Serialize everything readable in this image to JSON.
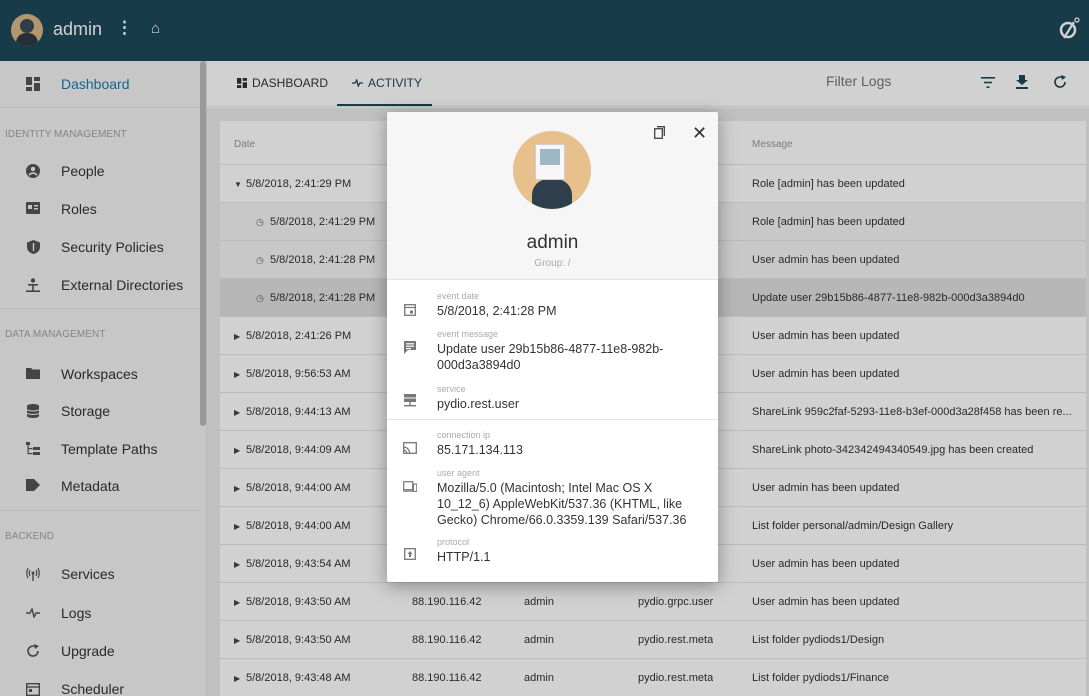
{
  "appbar": {
    "username": "admin",
    "kebab": "⋮",
    "home_icon": "home-icon",
    "logo_icon": "pydio-logo-icon"
  },
  "sidebar": {
    "dashboard": {
      "label": "Dashboard",
      "icon": "dashboard-icon"
    },
    "sections": {
      "identity": "IDENTITY MANAGEMENT",
      "data": "DATA MANAGEMENT",
      "backend": "BACKEND"
    },
    "identity_items": [
      {
        "label": "People",
        "icon": "person-icon"
      },
      {
        "label": "Roles",
        "icon": "badge-icon"
      },
      {
        "label": "Security Policies",
        "icon": "shield-icon"
      },
      {
        "label": "External Directories",
        "icon": "directory-icon"
      }
    ],
    "data_items": [
      {
        "label": "Workspaces",
        "icon": "folder-icon"
      },
      {
        "label": "Storage",
        "icon": "database-icon"
      },
      {
        "label": "Template Paths",
        "icon": "tree-icon"
      },
      {
        "label": "Metadata",
        "icon": "tag-icon"
      }
    ],
    "backend_items": [
      {
        "label": "Services",
        "icon": "antenna-icon"
      },
      {
        "label": "Logs",
        "icon": "pulse-icon"
      },
      {
        "label": "Upgrade",
        "icon": "refresh-icon"
      },
      {
        "label": "Scheduler",
        "icon": "calendar-icon"
      }
    ]
  },
  "tabs": [
    {
      "label": "DASHBOARD",
      "icon": "dashboard-icon"
    },
    {
      "label": "ACTIVITY",
      "icon": "pulse-icon"
    }
  ],
  "toolbar": {
    "filter_placeholder": "Filter Logs",
    "filter_icon": "filter-icon",
    "download_icon": "download-icon",
    "refresh_icon": "refresh-icon"
  },
  "table": {
    "headers": {
      "date": "Date",
      "message": "Message"
    },
    "rows": [
      {
        "date": "5/8/2018, 2:41:29 PM",
        "ip": "",
        "user": "",
        "service": "",
        "message": "Role [admin] has been updated",
        "kind": "expanded"
      },
      {
        "date": "5/8/2018, 2:41:29 PM",
        "ip": "",
        "user": "",
        "service": "",
        "message": "Role [admin] has been updated",
        "kind": "sub"
      },
      {
        "date": "5/8/2018, 2:41:28 PM",
        "ip": "",
        "user": "",
        "service": "",
        "message": "User admin has been updated",
        "kind": "sub"
      },
      {
        "date": "5/8/2018, 2:41:28 PM",
        "ip": "",
        "user": "",
        "service": "",
        "message": "Update user 29b15b86-4877-11e8-982b-000d3a3894d0",
        "kind": "selected"
      },
      {
        "date": "5/8/2018, 2:41:26 PM",
        "ip": "",
        "user": "",
        "service": "",
        "message": "User admin has been updated",
        "kind": "collapsed"
      },
      {
        "date": "5/8/2018, 9:56:53 AM",
        "ip": "",
        "user": "",
        "service": "",
        "message": "User admin has been updated",
        "kind": "collapsed"
      },
      {
        "date": "5/8/2018, 9:44:13 AM",
        "ip": "",
        "user": "",
        "service": "",
        "message": "ShareLink 959c2faf-5293-11e8-b3ef-000d3a28f458 has been re...",
        "kind": "collapsed"
      },
      {
        "date": "5/8/2018, 9:44:09 AM",
        "ip": "",
        "user": "",
        "service": "",
        "message": "ShareLink photo-342342494340549.jpg has been created",
        "kind": "collapsed"
      },
      {
        "date": "5/8/2018, 9:44:00 AM",
        "ip": "",
        "user": "",
        "service": "",
        "message": "User admin has been updated",
        "kind": "collapsed"
      },
      {
        "date": "5/8/2018, 9:44:00 AM",
        "ip": "",
        "user": "",
        "service": "",
        "message": "List folder personal/admin/Design Gallery",
        "kind": "collapsed"
      },
      {
        "date": "5/8/2018, 9:43:54 AM",
        "ip": "",
        "user": "",
        "service": "",
        "message": "User admin has been updated",
        "kind": "collapsed"
      },
      {
        "date": "5/8/2018, 9:43:50 AM",
        "ip": "88.190.116.42",
        "user": "admin",
        "service": "pydio.grpc.user",
        "message": "User admin has been updated",
        "kind": "collapsed"
      },
      {
        "date": "5/8/2018, 9:43:50 AM",
        "ip": "88.190.116.42",
        "user": "admin",
        "service": "pydio.rest.meta",
        "message": "List folder pydiods1/Design",
        "kind": "collapsed"
      },
      {
        "date": "5/8/2018, 9:43:48 AM",
        "ip": "88.190.116.42",
        "user": "admin",
        "service": "pydio.rest.meta",
        "message": "List folder pydiods1/Finance",
        "kind": "collapsed"
      }
    ]
  },
  "modal": {
    "name": "admin",
    "group": "Group: /",
    "copy_icon": "copy-icon",
    "close_icon": "close-icon",
    "fields": [
      {
        "label": "event date",
        "value": "5/8/2018, 2:41:28 PM",
        "icon": "calendar-icon"
      },
      {
        "label": "event message",
        "value": "Update user 29b15b86-4877-11e8-982b-000d3a3894d0",
        "icon": "message-icon"
      },
      {
        "label": "service",
        "value": "pydio.rest.user",
        "icon": "server-icon"
      },
      {
        "label": "connection ip",
        "value": "85.171.134.113",
        "icon": "cast-icon"
      },
      {
        "label": "user agent",
        "value": "Mozilla/5.0 (Macintosh; Intel Mac OS X 10_12_6) AppleWebKit/537.36 (KHTML, like Gecko) Chrome/66.0.3359.139 Safari/537.36",
        "icon": "devices-icon"
      },
      {
        "label": "protocol",
        "value": "HTTP/1.1",
        "icon": "upload-box-icon"
      }
    ]
  }
}
